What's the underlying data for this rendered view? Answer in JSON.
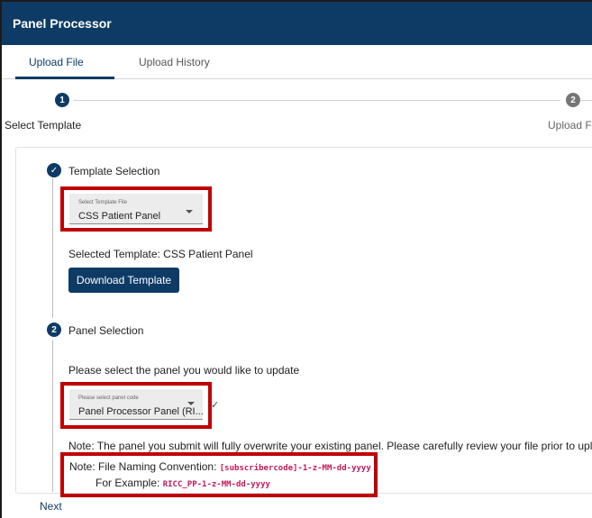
{
  "header": {
    "title": "Panel Processor"
  },
  "tabs": [
    {
      "label": "Upload File"
    },
    {
      "label": "Upload History"
    }
  ],
  "stepper": {
    "steps": [
      {
        "number": "1",
        "label": "Select Template"
      },
      {
        "number": "2",
        "label": "Upload Fi"
      }
    ]
  },
  "template_section": {
    "title": "Template Selection",
    "select_label": "Select Template File",
    "select_value": "CSS Patient Panel",
    "selected_text": "Selected Template: CSS Patient Panel",
    "download_button": "Download Template"
  },
  "panel_section": {
    "number": "2",
    "title": "Panel Selection",
    "prompt": "Please select the panel you would like to update",
    "select_label": "Please select panel code",
    "select_value": "Panel Processor Panel (RI...",
    "note_overwrite": "Note: The panel you submit will fully overwrite your existing panel. Please carefully review your file prior to upload.",
    "note_naming_prefix": "Note: File Naming Convention:",
    "note_naming_pattern": "[subscribercode]-1-z-MM-dd-yyyy",
    "example_prefix": "For Example:",
    "example_value": "RICC_PP-1-z-MM-dd-yyyy"
  },
  "footer": {
    "next_label": "Next"
  },
  "colors": {
    "primary": "#0d3b66",
    "highlight": "#c00000",
    "code": "#c2185b"
  }
}
